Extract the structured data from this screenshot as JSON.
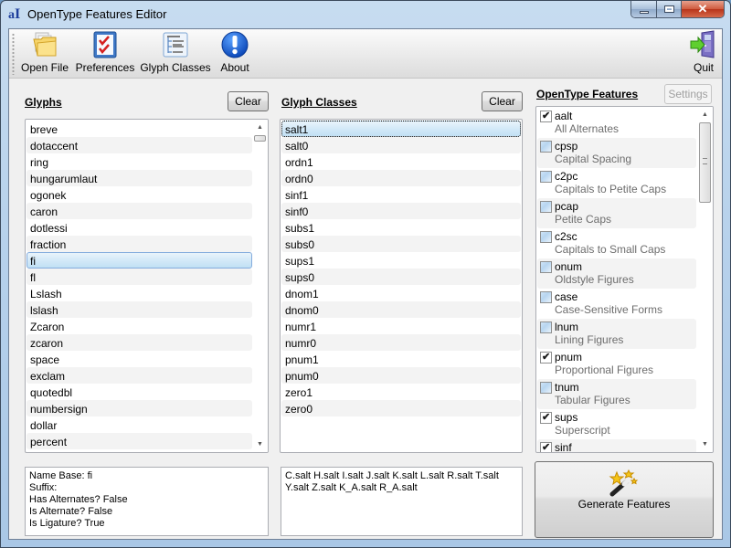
{
  "window": {
    "title": "OpenType Features Editor"
  },
  "toolbar": {
    "open_file": "Open File",
    "preferences": "Preferences",
    "glyph_classes": "Glyph Classes",
    "about": "About",
    "quit": "Quit"
  },
  "glyphs": {
    "label": "Glyphs",
    "clear": "Clear",
    "items": [
      "breve",
      "dotaccent",
      "ring",
      "hungarumlaut",
      "ogonek",
      "caron",
      "dotlessi",
      "fraction",
      "fi",
      "fl",
      "Lslash",
      "lslash",
      "Zcaron",
      "zcaron",
      "space",
      "exclam",
      "quotedbl",
      "numbersign",
      "dollar",
      "percent"
    ],
    "selected": "fi",
    "info": "Name Base: fi\nSuffix:\nHas Alternates? False\nIs Alternate? False\nIs Ligature? True"
  },
  "glyph_classes": {
    "label": "Glyph Classes",
    "clear": "Clear",
    "items": [
      "salt1",
      "salt0",
      "ordn1",
      "ordn0",
      "sinf1",
      "sinf0",
      "subs1",
      "subs0",
      "sups1",
      "sups0",
      "dnom1",
      "dnom0",
      "numr1",
      "numr0",
      "pnum1",
      "pnum0",
      "zero1",
      "zero0"
    ],
    "selected": "salt1",
    "members": "C.salt H.salt I.salt J.salt K.salt L.salt R.salt T.salt\nY.salt Z.salt K_A.salt R_A.salt"
  },
  "features": {
    "label": "OpenType Features",
    "settings": "Settings",
    "items": [
      {
        "tag": "aalt",
        "name": "All Alternates",
        "checked": true
      },
      {
        "tag": "cpsp",
        "name": "Capital Spacing",
        "checked": false
      },
      {
        "tag": "c2pc",
        "name": "Capitals to Petite Caps",
        "checked": false
      },
      {
        "tag": "pcap",
        "name": "Petite Caps",
        "checked": false
      },
      {
        "tag": "c2sc",
        "name": "Capitals to Small Caps",
        "checked": false
      },
      {
        "tag": "onum",
        "name": "Oldstyle Figures",
        "checked": false
      },
      {
        "tag": "case",
        "name": "Case-Sensitive Forms",
        "checked": false
      },
      {
        "tag": "lnum",
        "name": "Lining Figures",
        "checked": false
      },
      {
        "tag": "pnum",
        "name": "Proportional Figures",
        "checked": true
      },
      {
        "tag": "tnum",
        "name": "Tabular Figures",
        "checked": false
      },
      {
        "tag": "sups",
        "name": "Superscript",
        "checked": true
      },
      {
        "tag": "sinf",
        "name": "",
        "checked": true
      }
    ]
  },
  "generate": {
    "label": "Generate Features"
  },
  "icons": {
    "app": "app-logo-icon",
    "open_file": "folder-icon",
    "preferences": "checklist-icon",
    "glyph_classes": "tree-list-icon",
    "about": "info-exclamation-icon",
    "quit": "exit-door-icon",
    "generate": "magic-wand-icon"
  }
}
